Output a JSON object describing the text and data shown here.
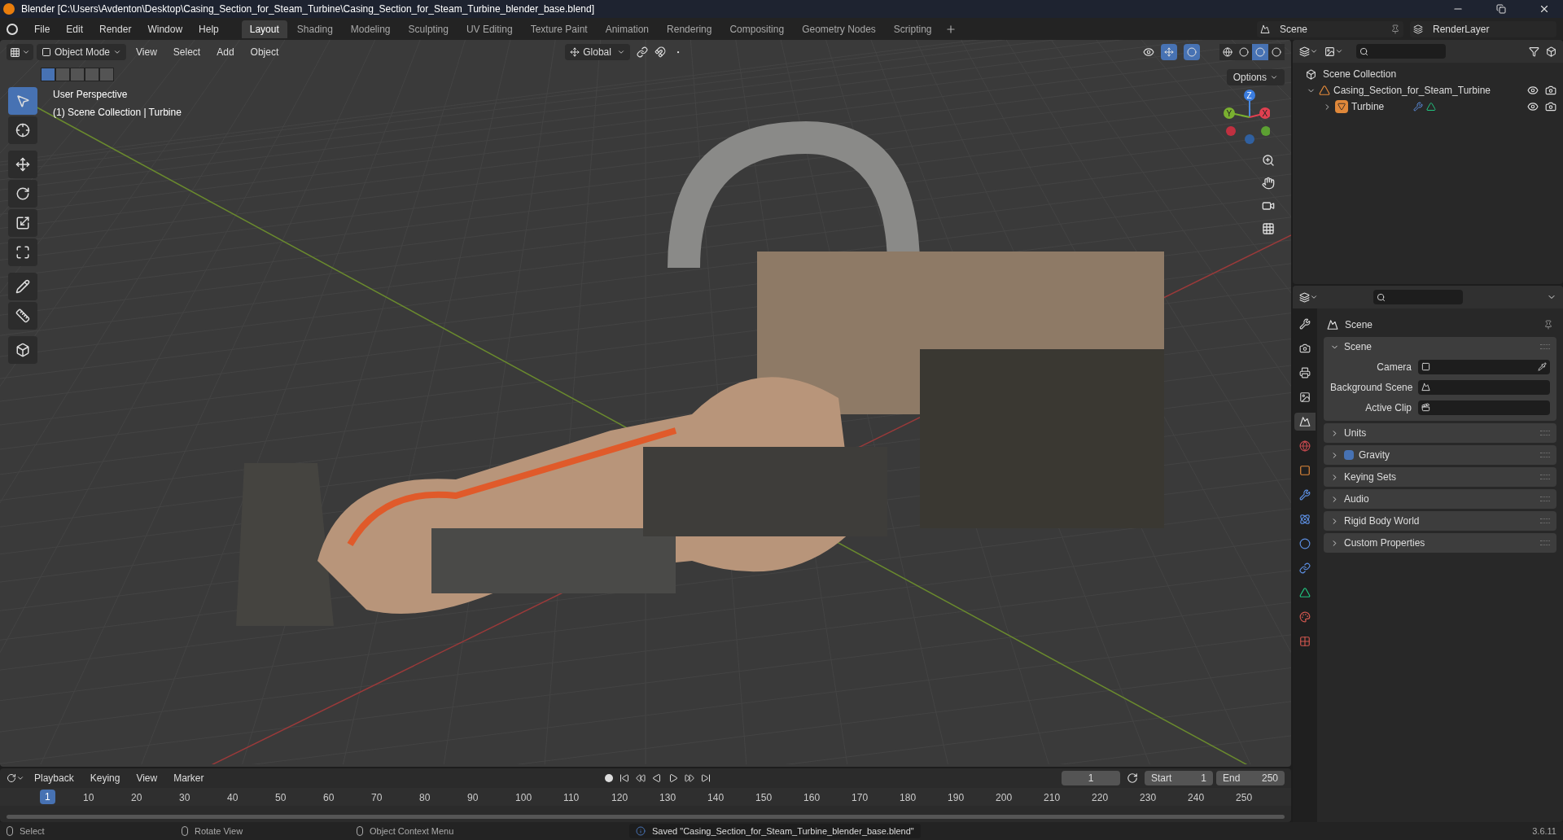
{
  "window": {
    "title": "Blender [C:\\Users\\Avdenton\\Desktop\\Casing_Section_for_Steam_Turbine\\Casing_Section_for_Steam_Turbine_blender_base.blend]"
  },
  "menu": [
    "File",
    "Edit",
    "Render",
    "Window",
    "Help"
  ],
  "workspaces": [
    {
      "label": "Layout",
      "selected": true
    },
    {
      "label": "Shading",
      "selected": false
    },
    {
      "label": "Modeling",
      "selected": false
    },
    {
      "label": "Sculpting",
      "selected": false
    },
    {
      "label": "UV Editing",
      "selected": false
    },
    {
      "label": "Texture Paint",
      "selected": false
    },
    {
      "label": "Animation",
      "selected": false
    },
    {
      "label": "Rendering",
      "selected": false
    },
    {
      "label": "Compositing",
      "selected": false
    },
    {
      "label": "Geometry Nodes",
      "selected": false
    },
    {
      "label": "Scripting",
      "selected": false
    }
  ],
  "scene_selector": "Scene",
  "view_layer": "RenderLayer",
  "viewport": {
    "mode": "Object Mode",
    "menus": [
      "View",
      "Select",
      "Add",
      "Object"
    ],
    "orientation": "Global",
    "options": "Options",
    "info": [
      "User Perspective",
      "(1) Scene Collection | Turbine"
    ],
    "tools": [
      {
        "kind": "select",
        "selected": true
      },
      {
        "kind": "cursor",
        "selected": false
      },
      {
        "kind": "move",
        "selected": false
      },
      {
        "kind": "rotate",
        "selected": false
      },
      {
        "kind": "scale",
        "selected": false
      },
      {
        "kind": "transform",
        "selected": false
      },
      {
        "kind": "annotate",
        "selected": false
      },
      {
        "kind": "measure",
        "selected": false
      },
      {
        "kind": "add-cube",
        "selected": false
      }
    ],
    "shading": [
      {
        "kind": "wireframe",
        "selected": false
      },
      {
        "kind": "solid",
        "selected": false
      },
      {
        "kind": "material",
        "selected": true
      },
      {
        "kind": "rendered",
        "selected": false
      }
    ],
    "gizmo": {
      "z": "Z",
      "y": "Y",
      "x": "X"
    }
  },
  "outliner": {
    "root": "Scene Collection",
    "items": [
      {
        "label": "Casing_Section_for_Steam_Turbine",
        "expanded": true,
        "children": [
          {
            "label": "Turbine",
            "expanded": false
          }
        ]
      }
    ]
  },
  "properties": {
    "title": "Scene",
    "tabs": [
      {
        "kind": "tool",
        "selected": false
      },
      {
        "kind": "render",
        "selected": false
      },
      {
        "kind": "output",
        "selected": false
      },
      {
        "kind": "view-layer",
        "selected": false
      },
      {
        "kind": "scene",
        "selected": true
      },
      {
        "kind": "world",
        "selected": false
      },
      {
        "kind": "object",
        "selected": false
      },
      {
        "kind": "modifier",
        "selected": false
      },
      {
        "kind": "particles",
        "selected": false
      },
      {
        "kind": "physics",
        "selected": false
      },
      {
        "kind": "constraints",
        "selected": false
      },
      {
        "kind": "data",
        "selected": false
      },
      {
        "kind": "material",
        "selected": false
      },
      {
        "kind": "texture",
        "selected": false
      }
    ],
    "panels": [
      {
        "title": "Scene",
        "expanded": true,
        "fields": [
          "Camera",
          "Background Scene",
          "Active Clip"
        ]
      },
      {
        "title": "Units",
        "expanded": false
      },
      {
        "title": "Gravity",
        "expanded": false,
        "checked": true
      },
      {
        "title": "Keying Sets",
        "expanded": false
      },
      {
        "title": "Audio",
        "expanded": false
      },
      {
        "title": "Rigid Body World",
        "expanded": false
      },
      {
        "title": "Custom Properties",
        "expanded": false
      }
    ]
  },
  "timeline": {
    "menus": [
      "Playback",
      "Keying",
      "View",
      "Marker"
    ],
    "current_frame": "1",
    "start_label": "Start",
    "start": "1",
    "end_label": "End",
    "end": "250",
    "ruler": [
      "1",
      "10",
      "20",
      "30",
      "40",
      "50",
      "60",
      "70",
      "80",
      "90",
      "100",
      "110",
      "120",
      "130",
      "140",
      "150",
      "160",
      "170",
      "180",
      "190",
      "200",
      "210",
      "220",
      "230",
      "240",
      "250"
    ]
  },
  "status_bar": {
    "hints": [
      "Select",
      "Rotate View",
      "Object Context Menu"
    ],
    "message": "Saved \"Casing_Section_for_Steam_Turbine_blender_base.blend\"",
    "version": "3.6.11"
  }
}
